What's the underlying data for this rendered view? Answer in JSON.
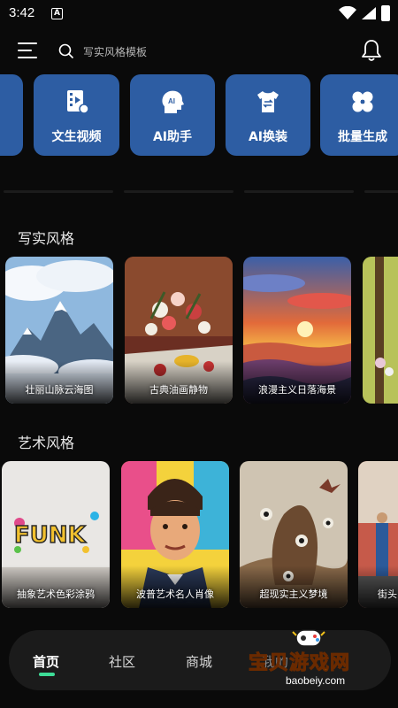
{
  "status_bar": {
    "time": "3:42",
    "notification_icon_letter": "A"
  },
  "header": {
    "search_placeholder": "写实风格模板"
  },
  "actions": [
    {
      "label": "",
      "icon": "partial-card"
    },
    {
      "label": "文生视频",
      "icon": "video-icon"
    },
    {
      "label": "AI助手",
      "icon": "ai-head-icon"
    },
    {
      "label": "AI换装",
      "icon": "shirt-swap-icon"
    },
    {
      "label": "批量生成",
      "icon": "clover-icon"
    }
  ],
  "sections": [
    {
      "title": "写实风格",
      "cards": [
        {
          "caption": "壮丽山脉云海图"
        },
        {
          "caption": "古典油画静物"
        },
        {
          "caption": "浪漫主义日落海景"
        },
        {
          "caption": ""
        }
      ]
    },
    {
      "title": "艺术风格",
      "cards": [
        {
          "caption": "抽象艺术色彩涂鸦"
        },
        {
          "caption": "波普艺术名人肖像"
        },
        {
          "caption": "超现实主义梦境"
        },
        {
          "caption": "街头"
        }
      ]
    }
  ],
  "bottom_nav": [
    {
      "label": "首页",
      "active": true
    },
    {
      "label": "社区",
      "active": false
    },
    {
      "label": "商城",
      "active": false
    },
    {
      "label": "我的",
      "active": false
    }
  ],
  "graffiti_text": "FUNK",
  "watermark": {
    "title": "宝贝游戏网",
    "url": "baobeiy.com"
  },
  "colors": {
    "accent_card": "#2d5da3",
    "nav_indicator": "#3ddc97",
    "background": "#0a0a0a"
  }
}
